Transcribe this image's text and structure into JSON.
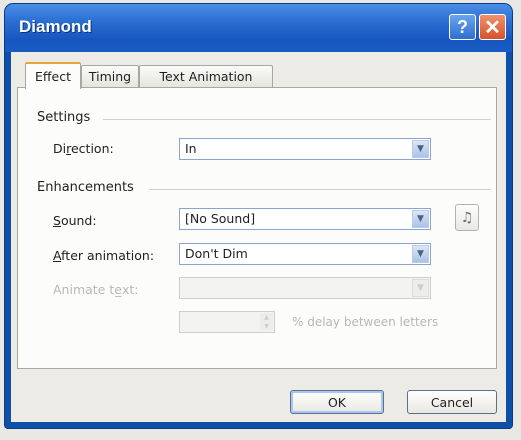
{
  "window": {
    "title": "Diamond",
    "help_glyph": "?",
    "close_glyph": "✕"
  },
  "tabs": [
    {
      "label": "Effect",
      "active": true
    },
    {
      "label": "Timing",
      "active": false
    },
    {
      "label": "Text Animation",
      "active": false
    }
  ],
  "settings": {
    "group_label": "Settings",
    "direction": {
      "label_prefix": "Di",
      "label_accel": "r",
      "label_suffix": "ection:",
      "value": "In"
    }
  },
  "enhancements": {
    "group_label": "Enhancements",
    "sound": {
      "label_accel": "S",
      "label_suffix": "ound:",
      "value": "[No Sound]"
    },
    "after_animation": {
      "label_accel": "A",
      "label_suffix": "fter animation:",
      "value": "Don't Dim"
    },
    "animate_text": {
      "label": "Animate te̲xt:",
      "value": "",
      "enabled": false
    },
    "delay": {
      "value": "",
      "label": "% delay between letters",
      "enabled": false
    }
  },
  "buttons": {
    "ok": "OK",
    "cancel": "Cancel"
  },
  "icons": {
    "sound_button": "speaker-icon",
    "dropdown": "chevron-down-icon"
  },
  "colors": {
    "titlebar": "#1656bf",
    "close": "#d6532a",
    "tab_highlight": "#e8a43a"
  }
}
